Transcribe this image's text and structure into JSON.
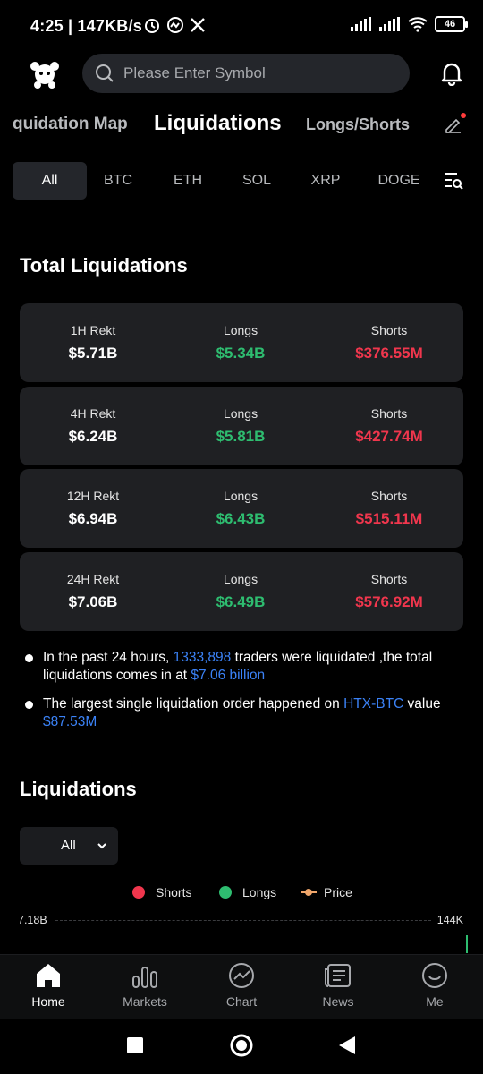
{
  "status_bar": {
    "time": "4:25",
    "speed": "147KB/s",
    "battery": "46"
  },
  "header": {
    "search_placeholder": "Please Enter Symbol"
  },
  "tabs": [
    {
      "label": "quidation Map"
    },
    {
      "label": "Liquidations"
    },
    {
      "label": "Longs/Shorts"
    }
  ],
  "coins": [
    {
      "label": "All"
    },
    {
      "label": "BTC"
    },
    {
      "label": "ETH"
    },
    {
      "label": "SOL"
    },
    {
      "label": "XRP"
    },
    {
      "label": "DOGE"
    }
  ],
  "total_liquidations": {
    "title": "Total Liquidations",
    "rows": [
      {
        "period": "1H Rekt",
        "total": "$5.71B",
        "longs_label": "Longs",
        "longs": "$5.34B",
        "shorts_label": "Shorts",
        "shorts": "$376.55M"
      },
      {
        "period": "4H Rekt",
        "total": "$6.24B",
        "longs_label": "Longs",
        "longs": "$5.81B",
        "shorts_label": "Shorts",
        "shorts": "$427.74M"
      },
      {
        "period": "12H Rekt",
        "total": "$6.94B",
        "longs_label": "Longs",
        "longs": "$6.43B",
        "shorts_label": "Shorts",
        "shorts": "$515.11M"
      },
      {
        "period": "24H Rekt",
        "total": "$7.06B",
        "longs_label": "Longs",
        "longs": "$6.49B",
        "shorts_label": "Shorts",
        "shorts": "$576.92M"
      }
    ]
  },
  "notes": {
    "n1_a": "In the past 24 hours, ",
    "n1_traders": "1333,898",
    "n1_b": " traders were liquidated ,the total liquidations comes in at ",
    "n1_total": "$7.06 billion",
    "n2_a": "The largest single liquidation order happened on ",
    "n2_pair": "HTX-BTC",
    "n2_b": " value ",
    "n2_value": "$87.53M"
  },
  "liquidations_chart": {
    "title": "Liquidations",
    "filter_value": "All",
    "legend": [
      {
        "name": "Shorts",
        "color": "#f0364d"
      },
      {
        "name": "Longs",
        "color": "#2ebd70"
      },
      {
        "name": "Price",
        "color": "#f0a66b"
      }
    ],
    "y_left_top": "7.18B",
    "y_right_top": "144K"
  },
  "bottom_nav": [
    {
      "label": "Home",
      "icon": "home-icon"
    },
    {
      "label": "Markets",
      "icon": "markets-icon"
    },
    {
      "label": "Chart",
      "icon": "chart-icon"
    },
    {
      "label": "News",
      "icon": "news-icon"
    },
    {
      "label": "Me",
      "icon": "me-icon"
    }
  ]
}
